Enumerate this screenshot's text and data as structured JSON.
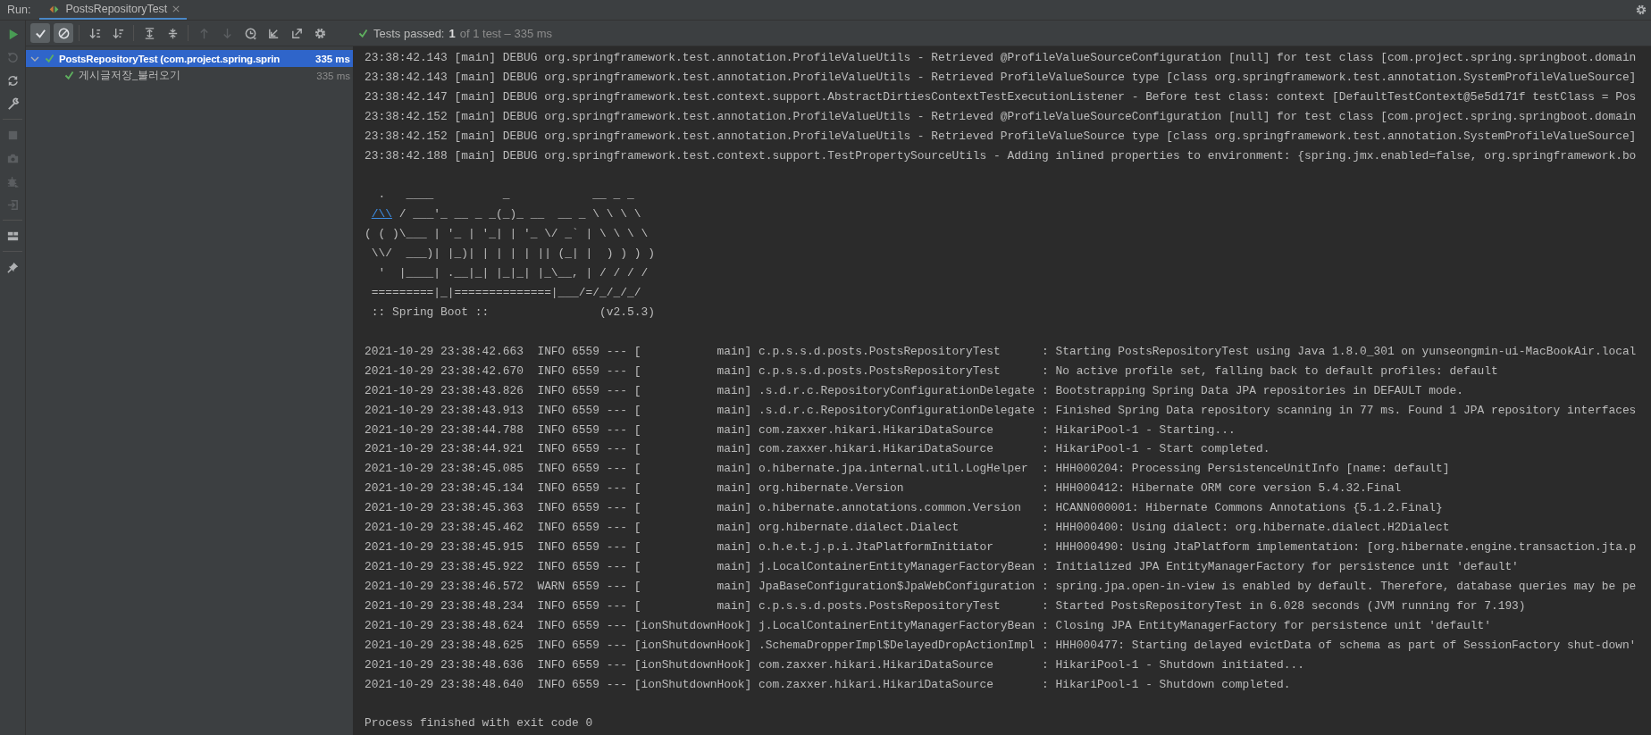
{
  "run_window": {
    "label": "Run:",
    "tabs": [
      {
        "label": "PostsRepositoryTest",
        "selected": true
      }
    ]
  },
  "side_toolbar": {
    "groups": [
      [
        {
          "kind": "run",
          "disabled": false
        },
        {
          "kind": "rerun-failed",
          "disabled": true
        },
        {
          "kind": "auto-test",
          "disabled": false
        },
        {
          "kind": "wrench",
          "disabled": false
        }
      ],
      [
        {
          "kind": "stop",
          "disabled": true
        },
        {
          "kind": "camera",
          "disabled": true
        },
        {
          "kind": "bug",
          "disabled": true
        },
        {
          "kind": "exit",
          "disabled": true
        }
      ],
      [
        {
          "kind": "layout",
          "disabled": false
        }
      ],
      [
        {
          "kind": "pin",
          "disabled": false
        }
      ]
    ]
  },
  "toolbar": {
    "groups": [
      [
        {
          "kind": "check",
          "on": true,
          "disabled": false
        },
        {
          "kind": "cancel",
          "on": true,
          "disabled": false
        }
      ],
      [
        {
          "kind": "sort-alpha",
          "on": false,
          "disabled": false
        },
        {
          "kind": "sort-duration",
          "on": false,
          "disabled": false
        }
      ],
      [
        {
          "kind": "expand",
          "on": false,
          "disabled": false
        },
        {
          "kind": "collapse",
          "on": false,
          "disabled": false
        }
      ],
      [
        {
          "kind": "up",
          "on": false,
          "disabled": true
        },
        {
          "kind": "down",
          "on": false,
          "disabled": true
        },
        {
          "kind": "history",
          "on": false,
          "disabled": false
        },
        {
          "kind": "import",
          "on": false,
          "disabled": false
        },
        {
          "kind": "export",
          "on": false,
          "disabled": false
        },
        {
          "kind": "gear",
          "on": false,
          "disabled": false
        }
      ]
    ],
    "status": {
      "passed": true,
      "label": "Tests passed:",
      "count": "1",
      "detail": "of 1 test – 335 ms"
    }
  },
  "tree": [
    {
      "label": "PostsRepositoryTest (com.project.spring.sprin",
      "time": "335 ms",
      "passed": true,
      "selected": true,
      "expanded": true,
      "children": [
        {
          "label": "게시글저장_불러오기",
          "time": "335 ms",
          "passed": true,
          "selected": false
        }
      ]
    }
  ],
  "console": {
    "lines": [
      {
        "kind": "log",
        "text": "23:38:42.143 [main] DEBUG org.springframework.test.annotation.ProfileValueUtils - Retrieved @ProfileValueSourceConfiguration [null] for test class [com.project.spring.springboot.domain"
      },
      {
        "kind": "log",
        "text": "23:38:42.143 [main] DEBUG org.springframework.test.annotation.ProfileValueUtils - Retrieved ProfileValueSource type [class org.springframework.test.annotation.SystemProfileValueSource]"
      },
      {
        "kind": "log",
        "text": "23:38:42.147 [main] DEBUG org.springframework.test.context.support.AbstractDirtiesContextTestExecutionListener - Before test class: context [DefaultTestContext@5e5d171f testClass = Pos"
      },
      {
        "kind": "log",
        "text": "23:38:42.152 [main] DEBUG org.springframework.test.annotation.ProfileValueUtils - Retrieved @ProfileValueSourceConfiguration [null] for test class [com.project.spring.springboot.domain"
      },
      {
        "kind": "log",
        "text": "23:38:42.152 [main] DEBUG org.springframework.test.annotation.ProfileValueUtils - Retrieved ProfileValueSource type [class org.springframework.test.annotation.SystemProfileValueSource]"
      },
      {
        "kind": "log",
        "text": "23:38:42.188 [main] DEBUG org.springframework.test.context.support.TestPropertySourceUtils - Adding inlined properties to environment: {spring.jmx.enabled=false, org.springframework.bo"
      },
      {
        "kind": "blank"
      },
      {
        "kind": "banner",
        "text": "  .   ____          _            __ _ _"
      },
      {
        "kind": "banner-link",
        "link": "/\\\\",
        "text": " / ___'_ __ _ _(_)_ __  __ _ \\ \\ \\ \\"
      },
      {
        "kind": "banner",
        "text": "( ( )\\___ | '_ | '_| | '_ \\/ _` | \\ \\ \\ \\"
      },
      {
        "kind": "banner",
        "text": " \\\\/  ___)| |_)| | | | | || (_| |  ) ) ) )"
      },
      {
        "kind": "banner",
        "text": "  '  |____| .__|_| |_|_| |_\\__, | / / / /"
      },
      {
        "kind": "banner",
        "text": " =========|_|==============|___/=/_/_/_/"
      },
      {
        "kind": "banner",
        "text": " :: Spring Boot ::                (v2.5.3)"
      },
      {
        "kind": "blank"
      },
      {
        "kind": "log",
        "text": "2021-10-29 23:38:42.663  INFO 6559 --- [           main] c.p.s.s.d.posts.PostsRepositoryTest      : Starting PostsRepositoryTest using Java 1.8.0_301 on yunseongmin-ui-MacBookAir.local"
      },
      {
        "kind": "log",
        "text": "2021-10-29 23:38:42.670  INFO 6559 --- [           main] c.p.s.s.d.posts.PostsRepositoryTest      : No active profile set, falling back to default profiles: default"
      },
      {
        "kind": "log",
        "text": "2021-10-29 23:38:43.826  INFO 6559 --- [           main] .s.d.r.c.RepositoryConfigurationDelegate : Bootstrapping Spring Data JPA repositories in DEFAULT mode."
      },
      {
        "kind": "log",
        "text": "2021-10-29 23:38:43.913  INFO 6559 --- [           main] .s.d.r.c.RepositoryConfigurationDelegate : Finished Spring Data repository scanning in 77 ms. Found 1 JPA repository interfaces"
      },
      {
        "kind": "log",
        "text": "2021-10-29 23:38:44.788  INFO 6559 --- [           main] com.zaxxer.hikari.HikariDataSource       : HikariPool-1 - Starting..."
      },
      {
        "kind": "log",
        "text": "2021-10-29 23:38:44.921  INFO 6559 --- [           main] com.zaxxer.hikari.HikariDataSource       : HikariPool-1 - Start completed."
      },
      {
        "kind": "log",
        "text": "2021-10-29 23:38:45.085  INFO 6559 --- [           main] o.hibernate.jpa.internal.util.LogHelper  : HHH000204: Processing PersistenceUnitInfo [name: default]"
      },
      {
        "kind": "log",
        "text": "2021-10-29 23:38:45.134  INFO 6559 --- [           main] org.hibernate.Version                    : HHH000412: Hibernate ORM core version 5.4.32.Final"
      },
      {
        "kind": "log",
        "text": "2021-10-29 23:38:45.363  INFO 6559 --- [           main] o.hibernate.annotations.common.Version   : HCANN000001: Hibernate Commons Annotations {5.1.2.Final}"
      },
      {
        "kind": "log",
        "text": "2021-10-29 23:38:45.462  INFO 6559 --- [           main] org.hibernate.dialect.Dialect            : HHH000400: Using dialect: org.hibernate.dialect.H2Dialect"
      },
      {
        "kind": "log",
        "text": "2021-10-29 23:38:45.915  INFO 6559 --- [           main] o.h.e.t.j.p.i.JtaPlatformInitiator       : HHH000490: Using JtaPlatform implementation: [org.hibernate.engine.transaction.jta.p"
      },
      {
        "kind": "log",
        "text": "2021-10-29 23:38:45.922  INFO 6559 --- [           main] j.LocalContainerEntityManagerFactoryBean : Initialized JPA EntityManagerFactory for persistence unit 'default'"
      },
      {
        "kind": "log",
        "text": "2021-10-29 23:38:46.572  WARN 6559 --- [           main] JpaBaseConfiguration$JpaWebConfiguration : spring.jpa.open-in-view is enabled by default. Therefore, database queries may be pe"
      },
      {
        "kind": "log",
        "text": "2021-10-29 23:38:48.234  INFO 6559 --- [           main] c.p.s.s.d.posts.PostsRepositoryTest      : Started PostsRepositoryTest in 6.028 seconds (JVM running for 7.193)"
      },
      {
        "kind": "log",
        "text": "2021-10-29 23:38:48.624  INFO 6559 --- [ionShutdownHook] j.LocalContainerEntityManagerFactoryBean : Closing JPA EntityManagerFactory for persistence unit 'default'"
      },
      {
        "kind": "log",
        "text": "2021-10-29 23:38:48.625  INFO 6559 --- [ionShutdownHook] .SchemaDropperImpl$DelayedDropActionImpl : HHH000477: Starting delayed evictData of schema as part of SessionFactory shut-down'"
      },
      {
        "kind": "log",
        "text": "2021-10-29 23:38:48.636  INFO 6559 --- [ionShutdownHook] com.zaxxer.hikari.HikariDataSource       : HikariPool-1 - Shutdown initiated..."
      },
      {
        "kind": "log",
        "text": "2021-10-29 23:38:48.640  INFO 6559 --- [ionShutdownHook] com.zaxxer.hikari.HikariDataSource       : HikariPool-1 - Shutdown completed."
      },
      {
        "kind": "blank"
      },
      {
        "kind": "exit",
        "text": "Process finished with exit code 0"
      }
    ]
  }
}
